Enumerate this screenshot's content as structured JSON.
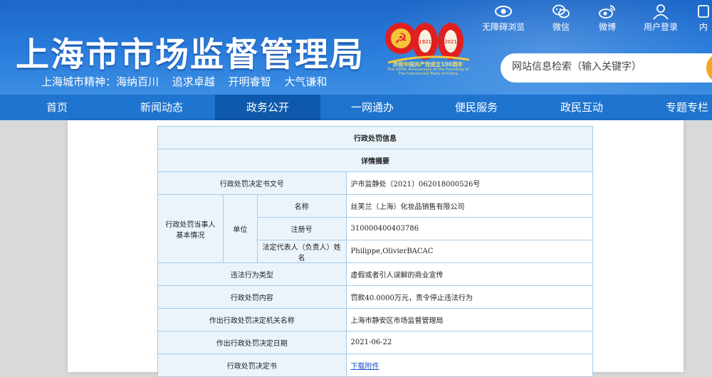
{
  "header": {
    "title": "上海市市场监督管理局",
    "slogan": [
      "上海城市精神：海纳百川",
      "追求卓越",
      "开明睿智",
      "大气谦和"
    ],
    "logo": {
      "number": "100",
      "year_left": "1921",
      "year_right": "2021",
      "caption": "庆祝中国共产党成立100周年",
      "caption_en": "The 100th Anniversary of the Founding of The Communist Party of China"
    }
  },
  "tools": [
    {
      "label": "无障碍浏览",
      "icon": "eye-icon"
    },
    {
      "label": "微信",
      "icon": "wechat-icon"
    },
    {
      "label": "微博",
      "icon": "weibo-icon"
    },
    {
      "label": "用户登录",
      "icon": "user-icon"
    },
    {
      "label": "内",
      "icon": "inner-icon"
    }
  ],
  "search": {
    "placeholder": "网站信息检索（输入关键字）"
  },
  "nav": [
    "首页",
    "新闻动态",
    "政务公开",
    "一网通办",
    "便民服务",
    "政民互动",
    "专题专栏"
  ],
  "nav_active": "政务公开",
  "table": {
    "title": "行政处罚信息",
    "summary": "详情摘要",
    "rows": {
      "decision_no_label": "行政处罚决定书文号",
      "decision_no": "沪市监静处〔2021〕062018000526号",
      "party_label": "行政处罚当事人基本情况",
      "unit_label": "单位",
      "name_label": "名称",
      "name": "丝芙兰（上海）化妆品销售有限公司",
      "reg_label": "注册号",
      "reg": "310000400403786",
      "rep_label": "法定代表人（负责人）姓名",
      "rep": "Philippe,OlivierBACAC",
      "violation_label": "违法行为类型",
      "violation": "虚假或者引人误解的商业宣传",
      "content_label": "行政处罚内容",
      "content": "罚款40.0000万元，责令停止违法行为",
      "authority_label": "作出行政处罚决定机关名称",
      "authority": "上海市静安区市场监督管理局",
      "date_label": "作出行政处罚决定日期",
      "date": "2021-06-22",
      "doc_label": "行政处罚决定书",
      "doc_link": "下载附件"
    }
  },
  "colors": {
    "header_blue": "#1c67c8",
    "nav_blue": "#1e74cf",
    "nav_active": "#0e59ab",
    "table_border": "#a9cbe6",
    "label_bg": "#ebf4fb"
  }
}
